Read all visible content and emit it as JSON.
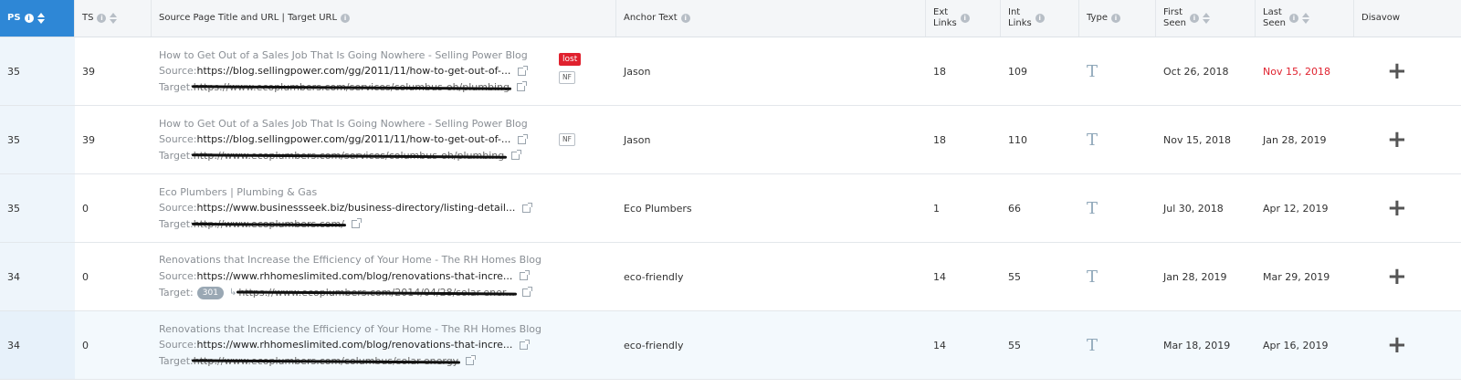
{
  "columns": {
    "ps": "PS",
    "ts": "TS",
    "source": "Source Page Title and URL | Target URL",
    "anchor": "Anchor Text",
    "ext_links": [
      "Ext",
      "Links"
    ],
    "int_links": [
      "Int",
      "Links"
    ],
    "type": "Type",
    "first_seen": [
      "First",
      "Seen"
    ],
    "last_seen": [
      "Last",
      "Seen"
    ],
    "disavow": "Disavow"
  },
  "labels": {
    "source": "Source: ",
    "target": "Target: ",
    "redirect_badge": "301",
    "lost_badge": "lost",
    "nf_badge": "NF",
    "disavow_action": "+"
  },
  "rows": [
    {
      "ps": "35",
      "ts": "39",
      "title": "How to Get Out of a Sales Job That Is Going Nowhere - Selling Power Blog",
      "source_url": "https://blog.sellingpower.com/gg/2011/11/how-to-get-out-of-...",
      "target_url": "https://www.ecoplumbers.com/services/columbus-oh/plumbing",
      "lost": true,
      "nf": true,
      "redirect": false,
      "anchor": "Jason",
      "ext": "18",
      "int": "109",
      "first_seen": "Oct 26, 2018",
      "last_seen": "Nov 15, 2018",
      "last_seen_lost": true
    },
    {
      "ps": "35",
      "ts": "39",
      "title": "How to Get Out of a Sales Job That Is Going Nowhere - Selling Power Blog",
      "source_url": "https://blog.sellingpower.com/gg/2011/11/how-to-get-out-of-...",
      "target_url": "http://www.ecoplumbers.com/services/columbus-oh/plumbing",
      "lost": false,
      "nf": true,
      "redirect": false,
      "anchor": "Jason",
      "ext": "18",
      "int": "110",
      "first_seen": "Nov 15, 2018",
      "last_seen": "Jan 28, 2019",
      "last_seen_lost": false
    },
    {
      "ps": "35",
      "ts": "0",
      "title": "Eco Plumbers | Plumbing & Gas",
      "source_url": "https://www.businessseek.biz/business-directory/listing-detail...",
      "target_url": "http://www.ecoplumbers.com/",
      "lost": false,
      "nf": false,
      "redirect": false,
      "anchor": "Eco Plumbers",
      "ext": "1",
      "int": "66",
      "first_seen": "Jul 30, 2018",
      "last_seen": "Apr 12, 2019",
      "last_seen_lost": false
    },
    {
      "ps": "34",
      "ts": "0",
      "title": "Renovations that Increase the Efficiency of Your Home - The RH Homes Blog",
      "source_url": "https://www.rhhomeslimited.com/blog/renovations-that-incre...",
      "target_url": "https://www.ecoplumbers.com/2014/04/28/solar-ener...",
      "lost": false,
      "nf": false,
      "redirect": true,
      "anchor": "eco-friendly",
      "ext": "14",
      "int": "55",
      "first_seen": "Jan 28, 2019",
      "last_seen": "Mar 29, 2019",
      "last_seen_lost": false
    },
    {
      "ps": "34",
      "ts": "0",
      "title": "Renovations that Increase the Efficiency of Your Home - The RH Homes Blog",
      "source_url": "https://www.rhhomeslimited.com/blog/renovations-that-incre...",
      "target_url": "http://www.ecoplumbers.com/columbus/solar-energy",
      "lost": false,
      "nf": false,
      "redirect": false,
      "anchor": "eco-friendly",
      "ext": "14",
      "int": "55",
      "first_seen": "Mar 18, 2019",
      "last_seen": "Apr 16, 2019",
      "last_seen_lost": false
    }
  ],
  "colors": {
    "header_active": "#2e87d6",
    "lost": "#e0212e",
    "row_highlight": "#f3f9fd"
  }
}
